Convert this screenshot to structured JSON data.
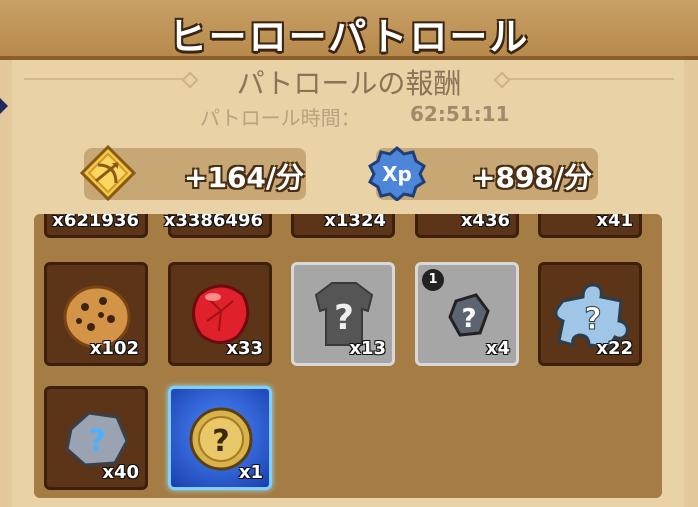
{
  "title": "ヒーローパトロール",
  "rewards_heading": "パトロールの報酬",
  "patrol_time": {
    "label": "パトロール時間：",
    "value": "62:51:11"
  },
  "rates": {
    "gold": "+164/分",
    "xp": "+898/分"
  },
  "icons": {
    "gold": "bow-emblem-icon",
    "xp": "xp-badge-icon"
  },
  "colors": {
    "panel": "#e8d2a6",
    "grid": "#a57c44",
    "slot": "#5c3417",
    "accent_blue": "#1a3fae"
  },
  "items_top_row": [
    {
      "qty": "x621936"
    },
    {
      "qty": "x3386496"
    },
    {
      "qty": "x1324"
    },
    {
      "qty": "x436"
    },
    {
      "qty": "x41"
    }
  ],
  "items": [
    {
      "name": "cookie-icon",
      "qty": "x102"
    },
    {
      "name": "red-gem-icon",
      "qty": "x33"
    },
    {
      "name": "mystery-armor-icon",
      "qty": "x13"
    },
    {
      "name": "mystery-shard-icon",
      "qty": "x4",
      "badge": "1"
    },
    {
      "name": "mystery-puzzle-icon",
      "qty": "x22"
    },
    {
      "name": "mystery-stone-icon",
      "qty": "x40"
    },
    {
      "name": "mystery-coin-icon",
      "qty": "x1"
    }
  ]
}
